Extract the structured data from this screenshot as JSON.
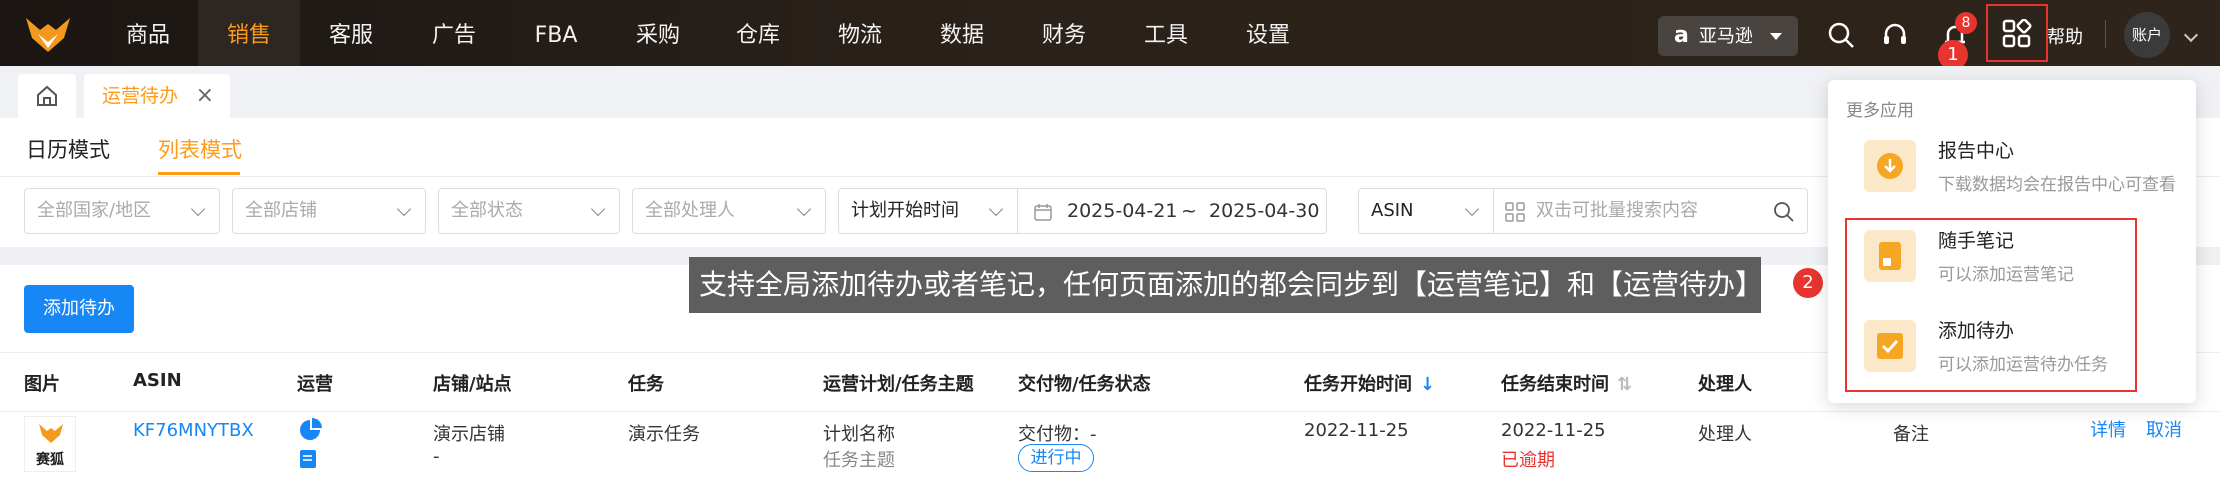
{
  "nav": {
    "items": [
      "商品",
      "销售",
      "客服",
      "广告",
      "FBA",
      "采购",
      "仓库",
      "物流",
      "数据",
      "财务",
      "工具",
      "设置"
    ],
    "active": "销售",
    "platform": "亚马逊",
    "platform_logo": "a",
    "notify_count": "8",
    "help": "帮助",
    "account": "账户",
    "accent": "#ff9a1a"
  },
  "tabs": {
    "open_tab": "运营待办",
    "close": "×"
  },
  "modes": [
    "日历模式",
    "列表模式"
  ],
  "active_mode": "列表模式",
  "filters": {
    "country": "全部国家/地区",
    "store": "全部店铺",
    "status": "全部状态",
    "handler": "全部处理人",
    "time_type": "计划开始时间",
    "date_start": "2025-04-21",
    "date_sep": "~",
    "date_end": "2025-04-30",
    "search_type": "ASIN",
    "search_placeholder": "双击可批量搜索内容"
  },
  "add_button": "添加待办",
  "tooltip": "支持全局添加待办或者笔记，任何页面添加的都会同步到【运营笔记】和【运营待办】",
  "step_badges": [
    "1",
    "2"
  ],
  "table": {
    "headers": [
      "图片",
      "ASIN",
      "运营",
      "店铺/站点",
      "任务",
      "运营计划/任务主题",
      "交付物/任务状态",
      "任务开始时间",
      "任务结束时间",
      "处理人"
    ],
    "row": {
      "image_label": "赛狐",
      "asin": "KF76MNYTBX",
      "store": "演示店铺",
      "site": "-",
      "task": "演示任务",
      "plan": "计划名称",
      "topic": "任务主题",
      "deliverable": "交付物：-",
      "status": "进行中",
      "start": "2022-11-25",
      "end": "2022-11-25",
      "overdue": "已逾期",
      "handler": "处理人",
      "note": "备注",
      "detail": "详情",
      "cancel": "取消"
    }
  },
  "more_apps": {
    "title": "更多应用",
    "items": [
      {
        "name": "报告中心",
        "desc": "下载数据均会在报告中心可查看",
        "icon": "download-icon"
      },
      {
        "name": "随手笔记",
        "desc": "可以添加运营笔记",
        "icon": "notebook-icon"
      },
      {
        "name": "添加待办",
        "desc": "可以添加运营待办任务",
        "icon": "checkbox-icon"
      }
    ]
  }
}
